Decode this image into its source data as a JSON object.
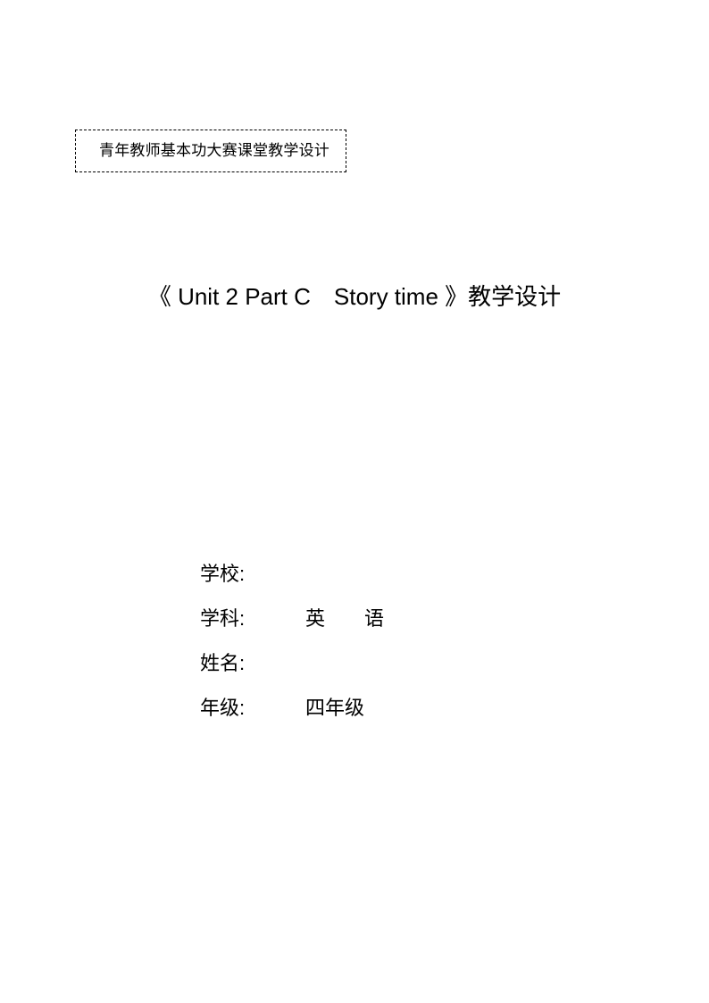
{
  "document": {
    "page_background": "#ffffff",
    "text_color": "#000000"
  },
  "stamp_box": {
    "text": "青年教师基本功大赛课堂教学设计",
    "border_style": "dashed",
    "border_color": "#000000"
  },
  "title": {
    "text": "《 Unit 2 Part C　Story time 》教学设计"
  },
  "meta": {
    "rows": [
      {
        "label": "学校:",
        "value": ""
      },
      {
        "label": "学科:",
        "value": "　英　　语"
      },
      {
        "label": "姓名:",
        "value": ""
      },
      {
        "label": "年级:",
        "value": "　四年级"
      }
    ]
  }
}
